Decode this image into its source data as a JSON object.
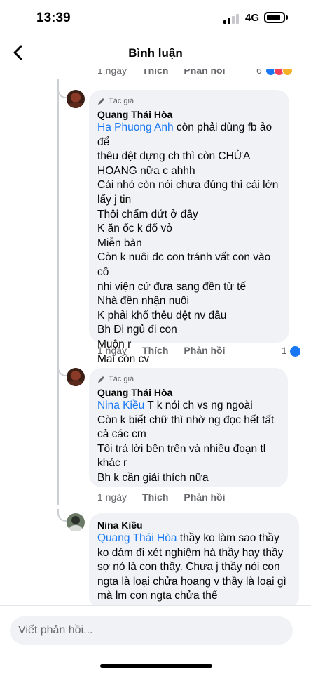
{
  "status": {
    "time": "13:39",
    "network": "4G"
  },
  "header": {
    "title": "Bình luận",
    "back_icon": "chevron-left-icon"
  },
  "top_meta": {
    "time": "1 ngày",
    "like": "Thích",
    "reply": "Phản hồi",
    "reaction_count": "6"
  },
  "comments": [
    {
      "badge": "Tác giả",
      "author": "Quang Thái Hòa",
      "mention": "Ha Phuong Anh",
      "lines": [
        " còn phải dùng fb ảo để",
        "thêu dệt dựng ch thì còn CHỬA",
        "HOANG nữa c ahhh",
        "Cái nhỏ còn nói chưa đúng thì cái lớn",
        "lấy j tin",
        "Thôi chấm dứt ở đây",
        "K ăn ốc k đổ vỏ",
        "Miễn bàn",
        "Còn k nuôi đc con tránh vất con vào cô",
        "nhi viện cứ đưa sang đền từ tế",
        "Nhà đền nhận nuôi",
        "K phải khổ thêu dệt nv đâu",
        "Bh Đi ngủ đi con",
        "Muộn r",
        "Mai còn cv"
      ],
      "time": "1 ngày",
      "like": "Thích",
      "reply": "Phản hồi",
      "reaction_count": "1"
    },
    {
      "badge": "Tác giả",
      "author": "Quang Thái Hòa",
      "mention": "Nina Kiều",
      "lines": [
        " T k nói ch vs ng ngoài",
        "Còn k biết chữ thì nhờ ng đọc hết tất",
        "cả các cm",
        "Tôi trả lời bên trên và nhiều đoạn tl",
        "khác r",
        "Bh k cần giải thích nữa"
      ],
      "time": "1 ngày",
      "like": "Thích",
      "reply": "Phản hồi"
    },
    {
      "author": "Nina Kiều",
      "mention": "Quang Thái Hòa",
      "lines": [
        " thầy ko làm sao thầy",
        "ko dám đi xét nghiệm hà thầy hay thầy",
        "sợ nó là con thầy. Chưa j thầy nói con",
        "ngta là loại chửa hoang v thầy là loại gì",
        "mà lm con ngta chửa thế"
      ]
    }
  ],
  "reply_box": {
    "placeholder": "Viết phản hồi..."
  },
  "colors": {
    "accent": "#1877f2",
    "bubble": "#f0f2f5",
    "meta": "#65676b"
  }
}
